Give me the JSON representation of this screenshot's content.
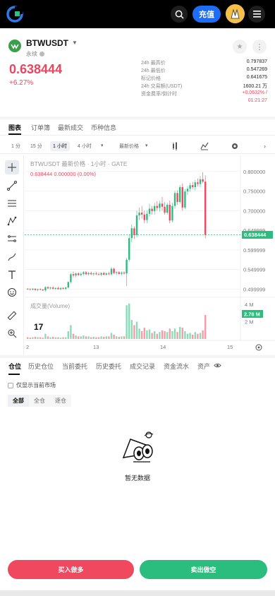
{
  "nav": {
    "deposit_label": "充值"
  },
  "symbol": {
    "name": "BTWUSDT",
    "sub": "永续",
    "price": "0.638444",
    "change": "+6.27%"
  },
  "stats": [
    {
      "k": "24h 最高价",
      "v": "0.797837"
    },
    {
      "k": "24h 最低价",
      "v": "0.547269"
    },
    {
      "k": "标记价格",
      "v": "0.641675"
    },
    {
      "k": "24h 交易额(USDT)",
      "v": "1600.21 万"
    },
    {
      "k": "资金费率/倒计时",
      "v": "+0.0632% /"
    },
    {
      "k": "",
      "v": "01:21:27"
    }
  ],
  "tabs": [
    "图表",
    "订单簿",
    "最新成交",
    "币种信息"
  ],
  "timeframes": {
    "t1": "1 分",
    "t2": "15 分",
    "t3": "1 小时",
    "t4": "4 小时",
    "price_type": "最新价格"
  },
  "chart": {
    "legend_title": "BTWUSDT 最新价格 · 1小时 · GATE",
    "legend_values": "0.638444  0.000000 (0.00%)",
    "volume_label": "成交量(Volume)",
    "price_label": "0.638444",
    "volume_value": "2.78 M"
  },
  "chart_data": {
    "type": "candlestick",
    "title": "BTWUSDT 最新价格 · 1小时 · GATE",
    "y_ticks": [
      "0.800000",
      "0.750000",
      "0.700000",
      "0.649999",
      "0.599999",
      "0.549999",
      "0.499999"
    ],
    "volume_ticks": [
      "4 M",
      "2 M"
    ],
    "x_ticks": [
      "2",
      "13",
      "14",
      "15"
    ],
    "last_price": 0.638444,
    "last_volume": "2.78 M",
    "ohlc": [
      [
        0.501,
        0.503,
        0.498,
        0.5
      ],
      [
        0.5,
        0.502,
        0.497,
        0.499
      ],
      [
        0.499,
        0.503,
        0.497,
        0.501
      ],
      [
        0.501,
        0.502,
        0.496,
        0.498
      ],
      [
        0.498,
        0.501,
        0.495,
        0.5
      ],
      [
        0.5,
        0.502,
        0.497,
        0.499
      ],
      [
        0.499,
        0.5,
        0.495,
        0.497
      ],
      [
        0.497,
        0.507,
        0.494,
        0.505
      ],
      [
        0.505,
        0.508,
        0.5,
        0.502
      ],
      [
        0.502,
        0.506,
        0.499,
        0.504
      ],
      [
        0.504,
        0.507,
        0.5,
        0.501
      ],
      [
        0.501,
        0.504,
        0.498,
        0.503
      ],
      [
        0.503,
        0.506,
        0.499,
        0.5
      ],
      [
        0.5,
        0.504,
        0.497,
        0.503
      ],
      [
        0.503,
        0.505,
        0.499,
        0.501
      ],
      [
        0.501,
        0.506,
        0.498,
        0.504
      ],
      [
        0.504,
        0.52,
        0.502,
        0.518
      ],
      [
        0.518,
        0.541,
        0.515,
        0.538
      ],
      [
        0.538,
        0.545,
        0.53,
        0.535
      ],
      [
        0.535,
        0.542,
        0.53,
        0.54
      ],
      [
        0.54,
        0.543,
        0.534,
        0.536
      ],
      [
        0.536,
        0.542,
        0.533,
        0.539
      ],
      [
        0.539,
        0.546,
        0.535,
        0.543
      ],
      [
        0.543,
        0.546,
        0.536,
        0.538
      ],
      [
        0.538,
        0.544,
        0.535,
        0.541
      ],
      [
        0.541,
        0.545,
        0.536,
        0.538
      ],
      [
        0.538,
        0.542,
        0.534,
        0.54
      ],
      [
        0.54,
        0.544,
        0.536,
        0.538
      ],
      [
        0.538,
        0.542,
        0.535,
        0.537
      ],
      [
        0.537,
        0.543,
        0.533,
        0.541
      ],
      [
        0.541,
        0.544,
        0.535,
        0.537
      ],
      [
        0.537,
        0.543,
        0.535,
        0.54
      ],
      [
        0.54,
        0.544,
        0.536,
        0.538
      ],
      [
        0.538,
        0.556,
        0.535,
        0.552
      ],
      [
        0.552,
        0.555,
        0.538,
        0.541
      ],
      [
        0.541,
        0.546,
        0.536,
        0.543
      ],
      [
        0.543,
        0.546,
        0.537,
        0.539
      ],
      [
        0.539,
        0.545,
        0.535,
        0.542
      ],
      [
        0.542,
        0.546,
        0.537,
        0.54
      ],
      [
        0.54,
        0.58,
        0.508,
        0.575
      ],
      [
        0.575,
        0.64,
        0.57,
        0.63
      ],
      [
        0.63,
        0.665,
        0.62,
        0.655
      ],
      [
        0.655,
        0.66,
        0.628,
        0.638
      ],
      [
        0.638,
        0.7,
        0.632,
        0.688
      ],
      [
        0.688,
        0.708,
        0.676,
        0.695
      ],
      [
        0.695,
        0.712,
        0.68,
        0.69
      ],
      [
        0.69,
        0.7,
        0.668,
        0.676
      ],
      [
        0.676,
        0.7,
        0.668,
        0.692
      ],
      [
        0.692,
        0.718,
        0.685,
        0.705
      ],
      [
        0.705,
        0.712,
        0.69,
        0.699
      ],
      [
        0.699,
        0.72,
        0.69,
        0.712
      ],
      [
        0.712,
        0.724,
        0.7,
        0.707
      ],
      [
        0.707,
        0.725,
        0.698,
        0.718
      ],
      [
        0.718,
        0.735,
        0.7,
        0.71
      ],
      [
        0.71,
        0.722,
        0.69,
        0.695
      ],
      [
        0.695,
        0.72,
        0.69,
        0.715
      ],
      [
        0.715,
        0.726,
        0.668,
        0.675
      ],
      [
        0.675,
        0.72,
        0.67,
        0.712
      ],
      [
        0.712,
        0.75,
        0.705,
        0.745
      ],
      [
        0.745,
        0.752,
        0.715,
        0.722
      ],
      [
        0.722,
        0.765,
        0.718,
        0.76
      ],
      [
        0.76,
        0.77,
        0.7,
        0.708
      ],
      [
        0.708,
        0.755,
        0.704,
        0.749
      ],
      [
        0.749,
        0.762,
        0.74,
        0.756
      ],
      [
        0.756,
        0.771,
        0.748,
        0.765
      ],
      [
        0.765,
        0.773,
        0.754,
        0.76
      ],
      [
        0.76,
        0.778,
        0.752,
        0.772
      ],
      [
        0.772,
        0.782,
        0.762,
        0.768
      ],
      [
        0.768,
        0.788,
        0.76,
        0.78
      ],
      [
        0.78,
        0.798,
        0.77,
        0.774
      ],
      [
        0.774,
        0.79,
        0.63,
        0.638
      ]
    ],
    "volumes": [
      0.2,
      0.15,
      0.2,
      0.25,
      0.2,
      0.2,
      0.15,
      0.6,
      0.3,
      0.2,
      0.25,
      0.2,
      0.2,
      0.15,
      0.2,
      0.2,
      0.9,
      1.6,
      0.6,
      0.4,
      0.3,
      0.3,
      0.4,
      0.3,
      0.3,
      0.2,
      0.25,
      0.2,
      0.2,
      0.3,
      0.25,
      0.3,
      0.3,
      0.7,
      0.5,
      0.3,
      0.25,
      0.3,
      0.3,
      3.9,
      4.1,
      2.2,
      1.6,
      2.0,
      1.2,
      0.9,
      1.3,
      1.0,
      1.1,
      0.7,
      0.9,
      0.6,
      0.8,
      1.0,
      0.9,
      0.8,
      1.2,
      0.9,
      1.2,
      0.8,
      1.4,
      1.3,
      0.9,
      0.6,
      0.7,
      0.5,
      0.8,
      0.6,
      0.7,
      1.0,
      2.78
    ]
  },
  "positions": {
    "tabs": [
      "仓位",
      "历史仓位",
      "当前委托",
      "历史委托",
      "成交记录",
      "资金流水",
      "资产"
    ],
    "only_current": "仅显示当前市场",
    "filters": [
      "全部",
      "全仓",
      "逐仓"
    ],
    "empty": "暂无数据"
  },
  "actions": {
    "buy": "买入做多",
    "sell": "卖出做空"
  },
  "colors": {
    "up": "#2bbd7e",
    "down": "#f0485e",
    "accent": "#1e6df6"
  }
}
